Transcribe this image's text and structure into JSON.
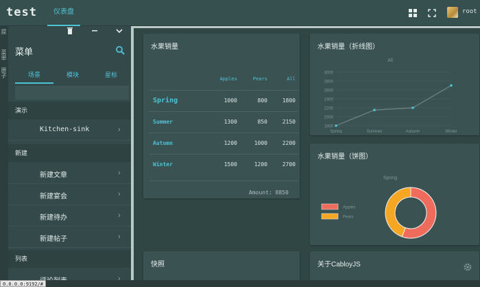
{
  "header": {
    "app_title": "test",
    "tab_dashboard": "仪表盘",
    "user_name": "root"
  },
  "left_strip": {
    "items": [
      "提",
      "菜单",
      "原子"
    ]
  },
  "panel": {
    "title": "菜单",
    "tabs": [
      "场景",
      "模块",
      "星标"
    ],
    "active_tab": 0,
    "groups": [
      {
        "label": "演示",
        "items": [
          "Kitchen-sink"
        ]
      },
      {
        "label": "新建",
        "items": [
          "新建文章",
          "新建宴会",
          "新建待办",
          "新建帖子"
        ]
      },
      {
        "label": "列表",
        "items": [
          "评论列表"
        ]
      }
    ]
  },
  "cards": {
    "table_title": "水果销量",
    "line_title": "水果销量（折线图）",
    "pie_title": "水果销量（饼图）",
    "snapshot_title": "快照",
    "about_title": "关于CabloyJS"
  },
  "table": {
    "headers": [
      "",
      "Apples",
      "Pears",
      "All"
    ],
    "rows": [
      [
        "Spring",
        "1000",
        "800",
        "1800"
      ],
      [
        "Summer",
        "1300",
        "850",
        "2150"
      ],
      [
        "Autumn",
        "1200",
        "1000",
        "2200"
      ],
      [
        "Winter",
        "1500",
        "1200",
        "2700"
      ]
    ],
    "amount": "Amount: 8850"
  },
  "chart_data": [
    {
      "type": "line",
      "title": "All",
      "categories": [
        "Spring",
        "Summer",
        "Autumn",
        "Winter"
      ],
      "series": [
        {
          "values": [
            1800,
            2150,
            2200,
            2700
          ]
        }
      ],
      "y_ticks": [
        "1800",
        "2000",
        "2200",
        "2400",
        "2600",
        "2800",
        "3000"
      ],
      "ylim": [
        1800,
        3000
      ],
      "color": "#4fc3d6"
    },
    {
      "type": "pie",
      "title": "Spring",
      "categories": [
        "Apples",
        "Pears"
      ],
      "values": [
        1000,
        800
      ],
      "colors": [
        "#ef6b5b",
        "#f5a623"
      ],
      "donut": true
    }
  ],
  "footer": {
    "url": "0.0.0.0:9192/#"
  },
  "colors": {
    "accent": "#4fc3d6",
    "background": "#2f4544",
    "card": "#3a5252"
  }
}
